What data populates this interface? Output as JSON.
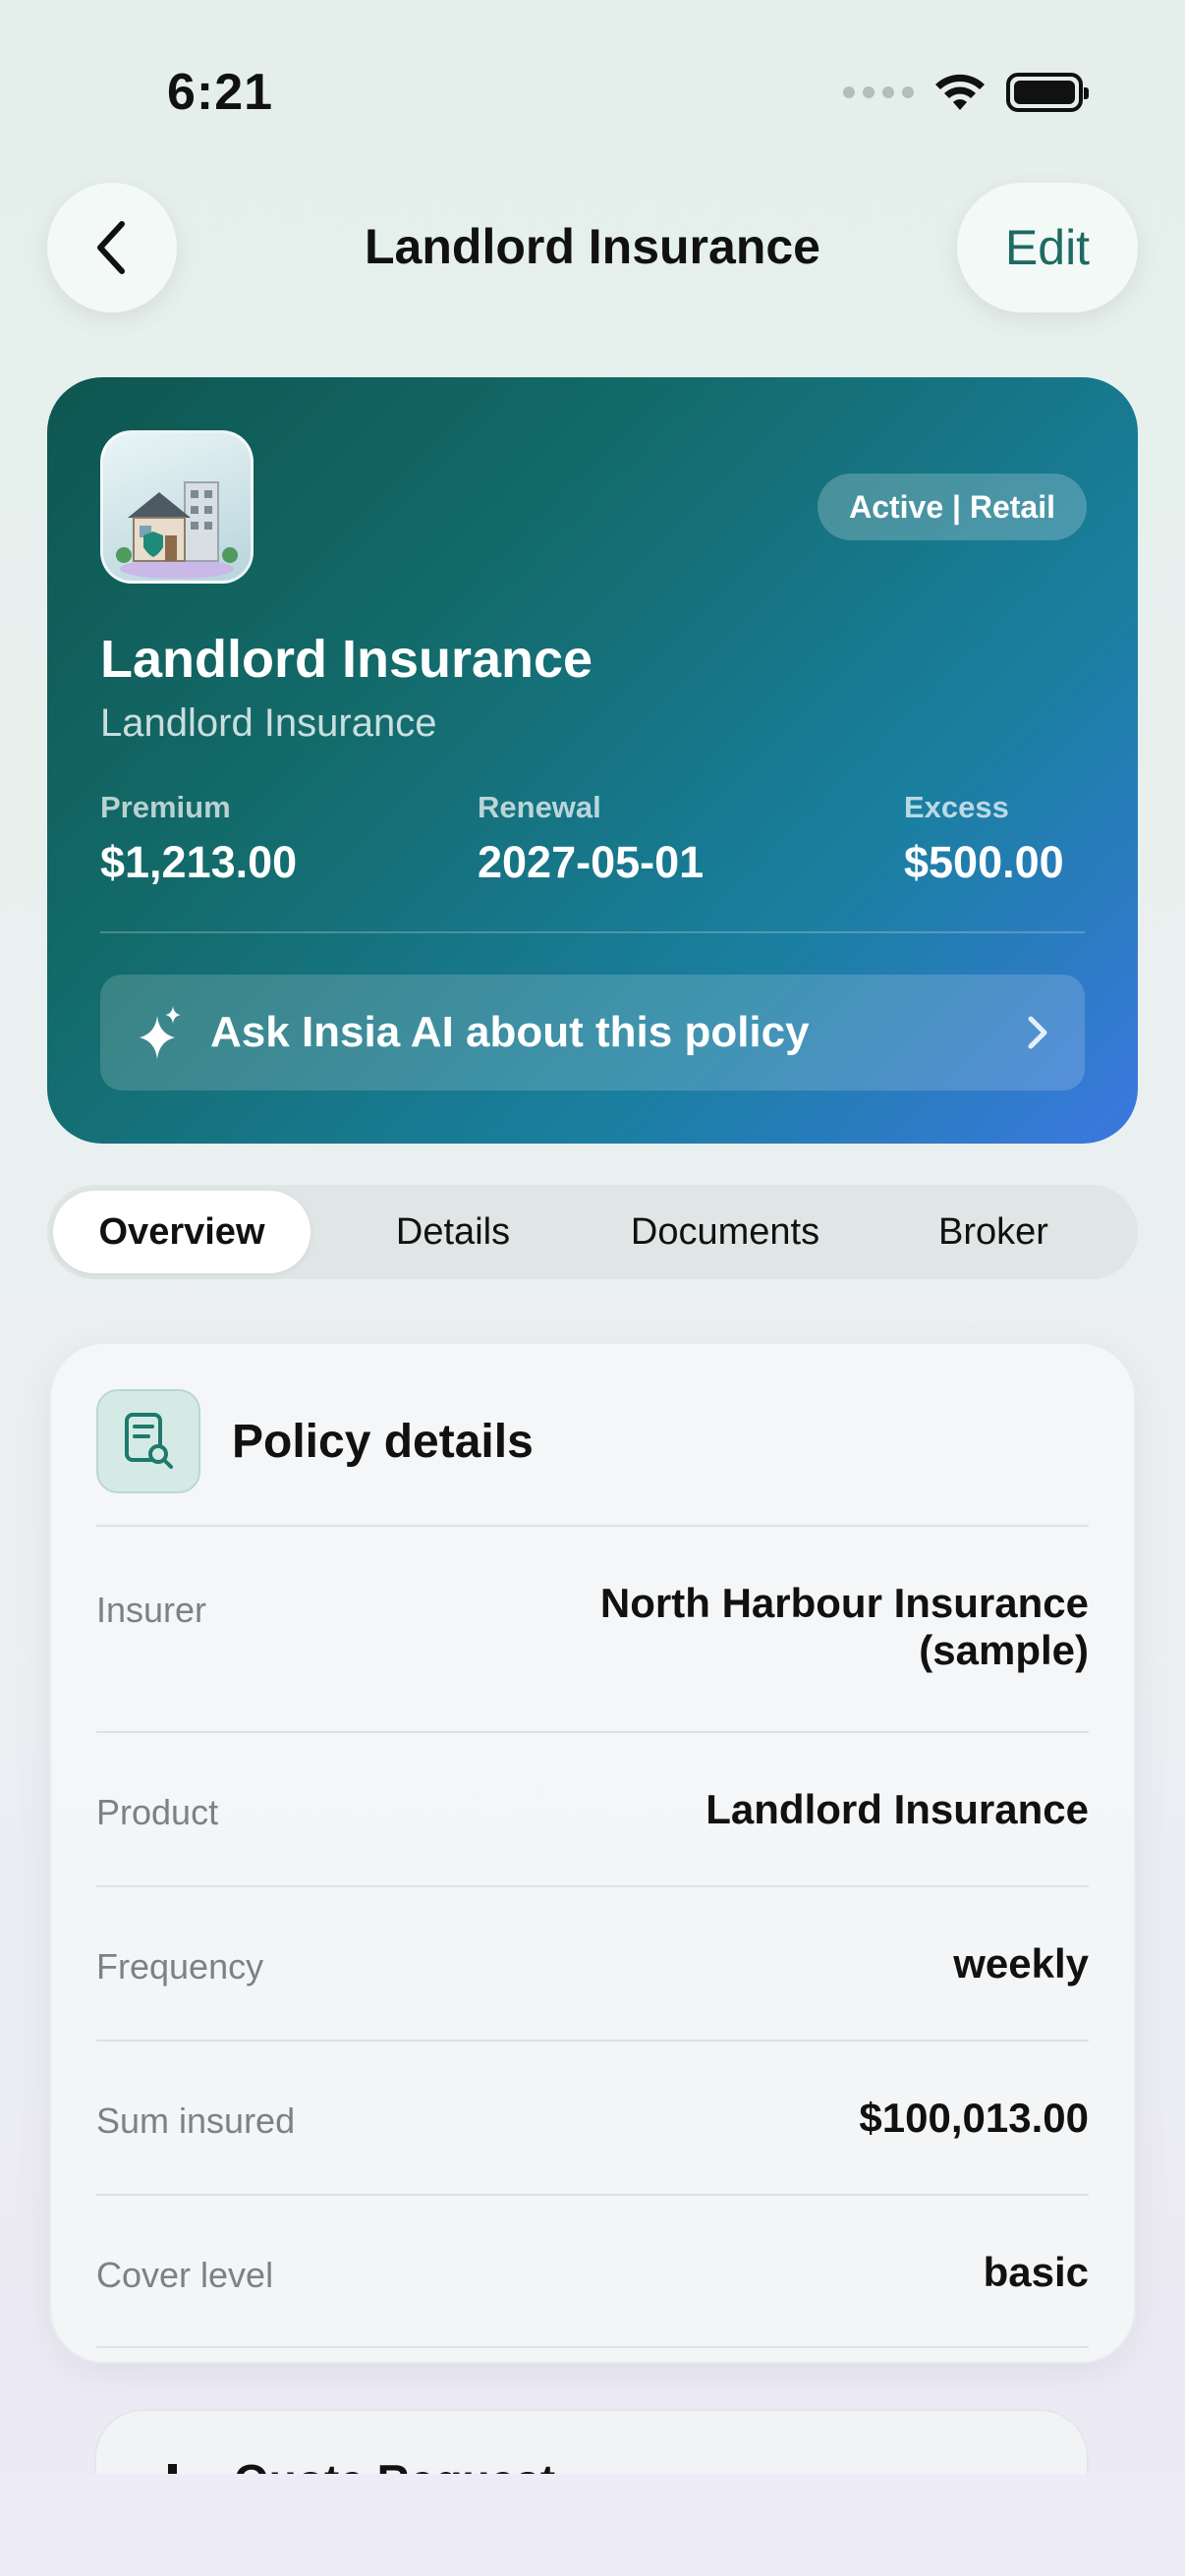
{
  "status_bar": {
    "time": "6:21"
  },
  "nav": {
    "title": "Landlord Insurance",
    "edit_label": "Edit"
  },
  "hero": {
    "badge": "Active | Retail",
    "title": "Landlord Insurance",
    "subtitle": "Landlord Insurance",
    "stats": [
      {
        "label": "Premium",
        "value": "$1,213.00"
      },
      {
        "label": "Renewal",
        "value": "2027-05-01"
      },
      {
        "label": "Excess",
        "value": "$500.00"
      }
    ],
    "ask_label": "Ask Insia AI about this policy"
  },
  "tabs": [
    "Overview",
    "Details",
    "Documents",
    "Broker"
  ],
  "policy_details": {
    "title": "Policy details",
    "rows": [
      {
        "key": "Insurer",
        "value_line1": "North Harbour Insurance",
        "value_line2": "(sample)"
      },
      {
        "key": "Product",
        "value": "Landlord Insurance"
      },
      {
        "key": "Frequency",
        "value": "weekly"
      },
      {
        "key": "Sum insured",
        "value": "$100,013.00"
      },
      {
        "key": "Cover level",
        "value": "basic"
      }
    ]
  },
  "quote_card": {
    "title": "Quote Request"
  }
}
